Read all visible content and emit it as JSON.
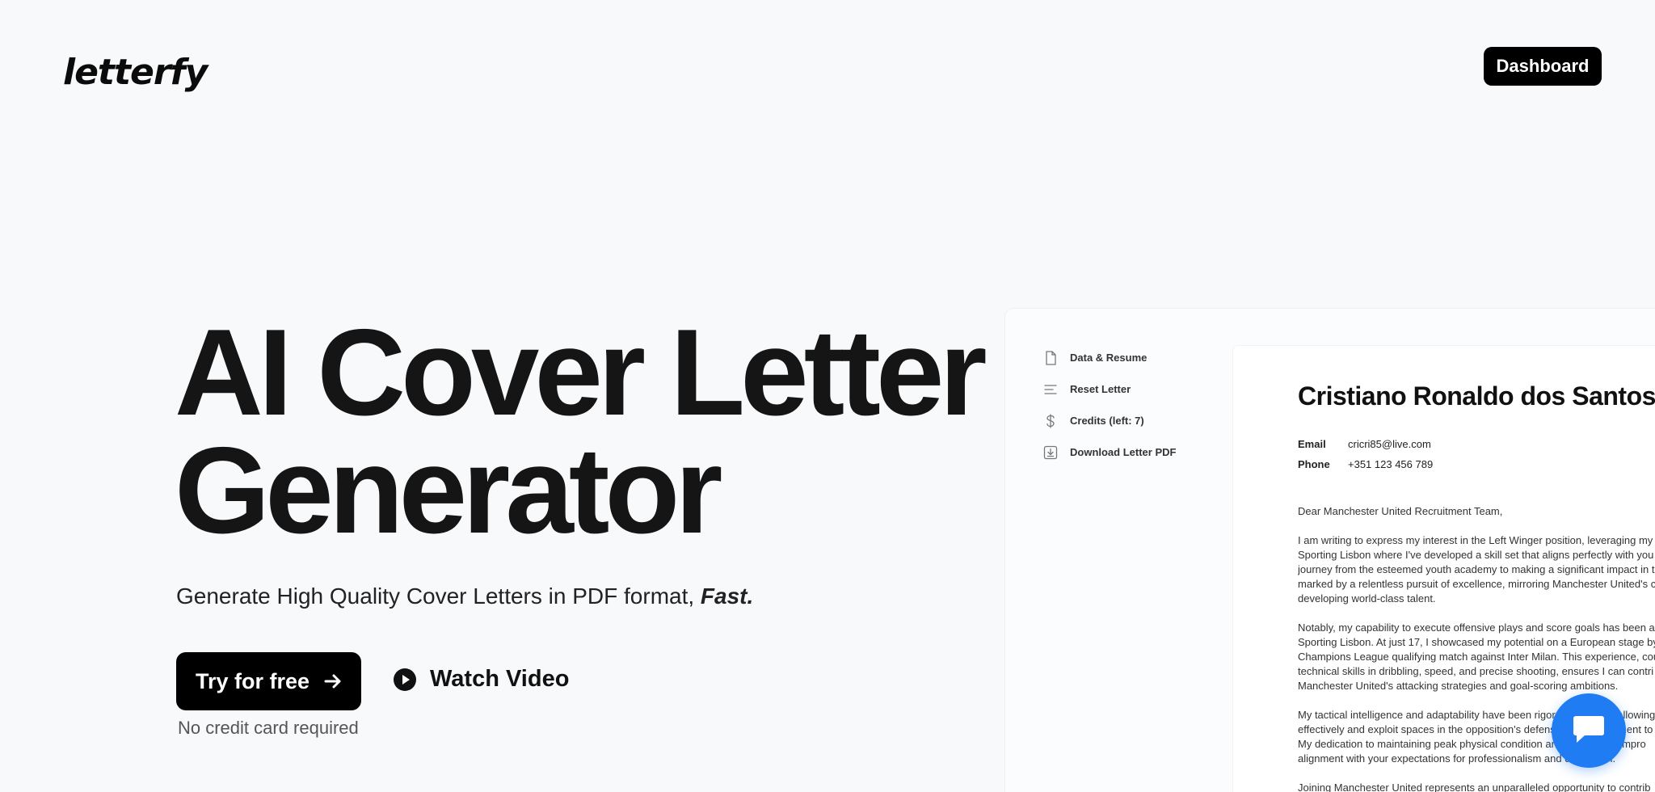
{
  "header": {
    "logo": "letterfy",
    "dashboard_label": "Dashboard"
  },
  "hero": {
    "title_line1": "AI Cover Letter",
    "title_line2": "Generator",
    "subtitle": "Generate High Quality Cover Letters in PDF format, ",
    "subtitle_emphasis": "Fast.",
    "try_label": "Try for free",
    "watch_label": "Watch Video",
    "no_cc": "No credit card required"
  },
  "preview": {
    "menu": [
      {
        "label": "Data & Resume",
        "icon": "file-icon"
      },
      {
        "label": "Reset Letter",
        "icon": "lines-icon"
      },
      {
        "label": "Credits (left: 7)",
        "icon": "dollar-icon"
      },
      {
        "label": "Download Letter PDF",
        "icon": "download-icon"
      }
    ],
    "letter": {
      "name": "Cristiano Ronaldo dos Santos",
      "email_label": "Email",
      "email": "cricri85@live.com",
      "phone_label": "Phone",
      "phone": "+351 123 456 789",
      "greeting": "Dear Manchester United Recruitment Team,",
      "para1": [
        "I am writing to express my interest in the Left Winger position, leveraging my p",
        "Sporting Lisbon where I've developed a skill set that aligns perfectly with you",
        "journey from the esteemed youth academy to making a significant impact in t",
        "marked by a relentless pursuit of excellence, mirroring Manchester United's c",
        "developing world-class talent."
      ],
      "para2": [
        "Notably, my capability to execute offensive plays and score goals has been a",
        "Sporting Lisbon. At just 17, I showcased my potential on a European stage by",
        "Champions League qualifying match against Inter Milan. This experience, cou",
        "technical skills in dribbling, speed, and precise shooting, ensures I can contri",
        "Manchester United's attacking strategies and goal-scoring ambitions."
      ],
      "para3": [
        "My tactical intelligence and adaptability have been rigorously tested, allowing",
        "effectively and exploit spaces in the opposition's defense. My commitment to",
        "My dedication to maintaining peak physical condition and continuous impro",
        "alignment with your expectations for professionalism and dedication."
      ],
      "para4": [
        "Joining Manchester United represents an unparalleled opportunity to contrib"
      ]
    }
  },
  "chat": {
    "icon": "chat-icon"
  },
  "colors": {
    "accent": "#1f7cf2",
    "primary": "#000000",
    "background": "#f7f9fb"
  }
}
